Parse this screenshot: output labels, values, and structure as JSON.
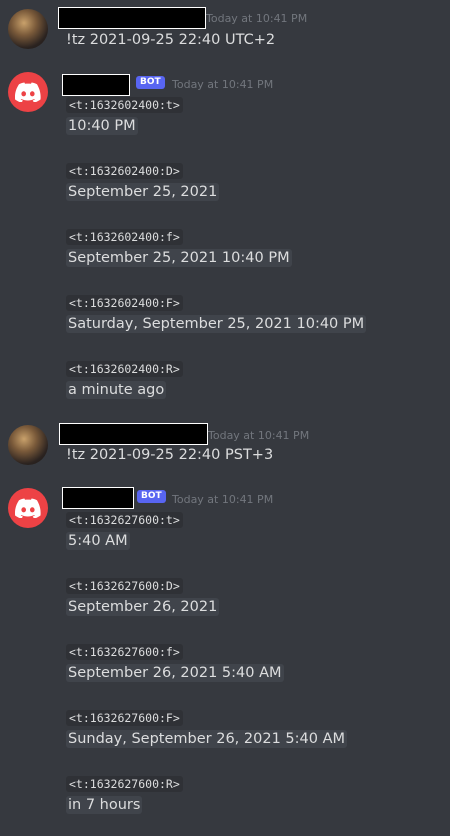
{
  "messages": [
    {
      "author_type": "user",
      "timestamp": "Today at 10:41 PM",
      "content": "!tz 2021-09-25 22:40 UTC+2"
    },
    {
      "author_type": "bot",
      "bot_tag": "BOT",
      "timestamp": "Today at 10:41 PM",
      "blocks": [
        {
          "code": "<t:1632602400:t>",
          "result": "10:40 PM"
        },
        {
          "code": "<t:1632602400:D>",
          "result": "September 25, 2021"
        },
        {
          "code": "<t:1632602400:f>",
          "result": "September 25, 2021 10:40 PM"
        },
        {
          "code": "<t:1632602400:F>",
          "result": "Saturday, September 25, 2021 10:40 PM"
        },
        {
          "code": "<t:1632602400:R>",
          "result": "a minute ago"
        }
      ]
    },
    {
      "author_type": "user",
      "timestamp": "Today at 10:41 PM",
      "content": "!tz 2021-09-25 22:40 PST+3"
    },
    {
      "author_type": "bot",
      "bot_tag": "BOT",
      "timestamp": "Today at 10:41 PM",
      "blocks": [
        {
          "code": "<t:1632627600:t>",
          "result": "5:40 AM"
        },
        {
          "code": "<t:1632627600:D>",
          "result": "September 26, 2021"
        },
        {
          "code": "<t:1632627600:f>",
          "result": "September 26, 2021 5:40 AM"
        },
        {
          "code": "<t:1632627600:F>",
          "result": "Sunday, September 26, 2021 5:40 AM"
        },
        {
          "code": "<t:1632627600:R>",
          "result": "in 7 hours"
        }
      ]
    }
  ],
  "colors": {
    "background": "#36393f",
    "bot_avatar": "#ed4245",
    "bot_tag": "#5865f2",
    "timestamp": "#72767d"
  },
  "icons": {
    "bot_avatar": "discord-logo-icon"
  }
}
